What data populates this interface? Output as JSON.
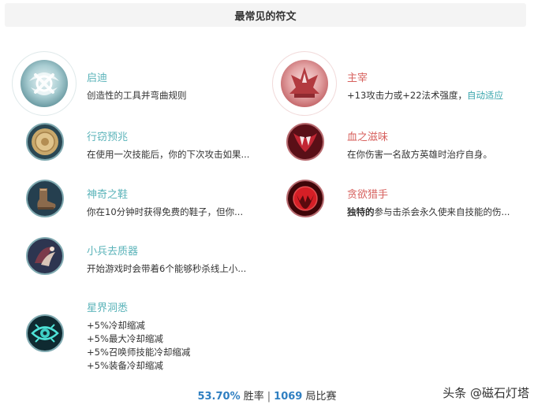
{
  "header": {
    "title": "最常见的符文"
  },
  "primary": [
    {
      "name": "启迪",
      "desc": "创造性的工具并弯曲规则"
    },
    {
      "name": "行窃预兆",
      "desc": "在使用一次技能后，你的下次攻击如果..."
    },
    {
      "name": "神奇之鞋",
      "desc": "你在10分钟时获得免费的鞋子，但你..."
    },
    {
      "name": "小兵去质器",
      "desc": "开始游戏时会带着6个能够秒杀线上小..."
    },
    {
      "name": "星界洞悉",
      "desc_lines": [
        "+5%冷却缩减",
        "+5%最大冷却缩减",
        "+5%召唤师技能冷却缩减",
        "+5%装备冷却缩减"
      ]
    }
  ],
  "secondary": [
    {
      "name": "主宰",
      "desc": "+13攻击力或+22法术强度，",
      "desc_highlight": "自动适应"
    },
    {
      "name": "血之滋味",
      "desc": "在你伤害一名敌方英雄时治疗自身。"
    },
    {
      "name": "贪欲猎手",
      "desc_bold": "独特的",
      "desc": "参与击杀会永久使来自技能的伤..."
    }
  ],
  "footer": {
    "winrate": "53.70%",
    "winrate_label": "胜率",
    "separator": "|",
    "games": "1069",
    "games_label": "局比赛"
  },
  "watermark": "头条 @磁石灯塔",
  "colors": {
    "teal_title": "#5ab3b9",
    "red_title": "#d7615e",
    "accent_number": "#2f7fc1",
    "highlight": "#3aa6ad"
  }
}
